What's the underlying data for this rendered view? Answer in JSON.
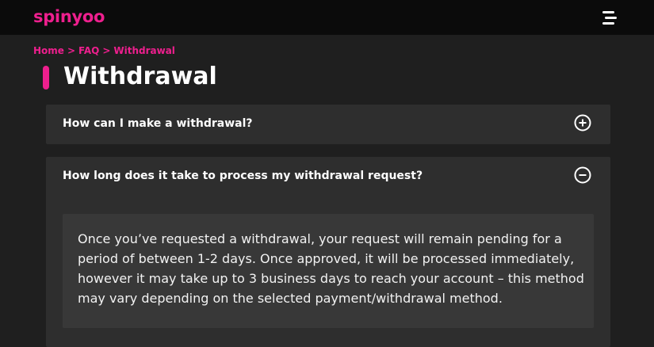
{
  "brand": {
    "logo_text": "spinyoo",
    "accent_color": "#ee1f8e"
  },
  "header": {
    "menu_icon": "hamburger-menu-icon"
  },
  "breadcrumb": {
    "items": [
      "Home",
      "FAQ",
      "Withdrawal"
    ],
    "separator": ">"
  },
  "page": {
    "title": "Withdrawal"
  },
  "faq": {
    "items": [
      {
        "question": "How can I make a withdrawal?",
        "expanded": false,
        "icon": "plus-circle-icon"
      },
      {
        "question": "How long does it take to process my withdrawal request?",
        "expanded": true,
        "icon": "minus-circle-icon",
        "answer": "Once you’ve requested a withdrawal, your request will remain pending for a period of between 1-2 days. Once approved, it will be processed immediately, however it may take up to 3 business days to reach your account – this method may vary depending on the selected payment/withdrawal method."
      }
    ]
  }
}
